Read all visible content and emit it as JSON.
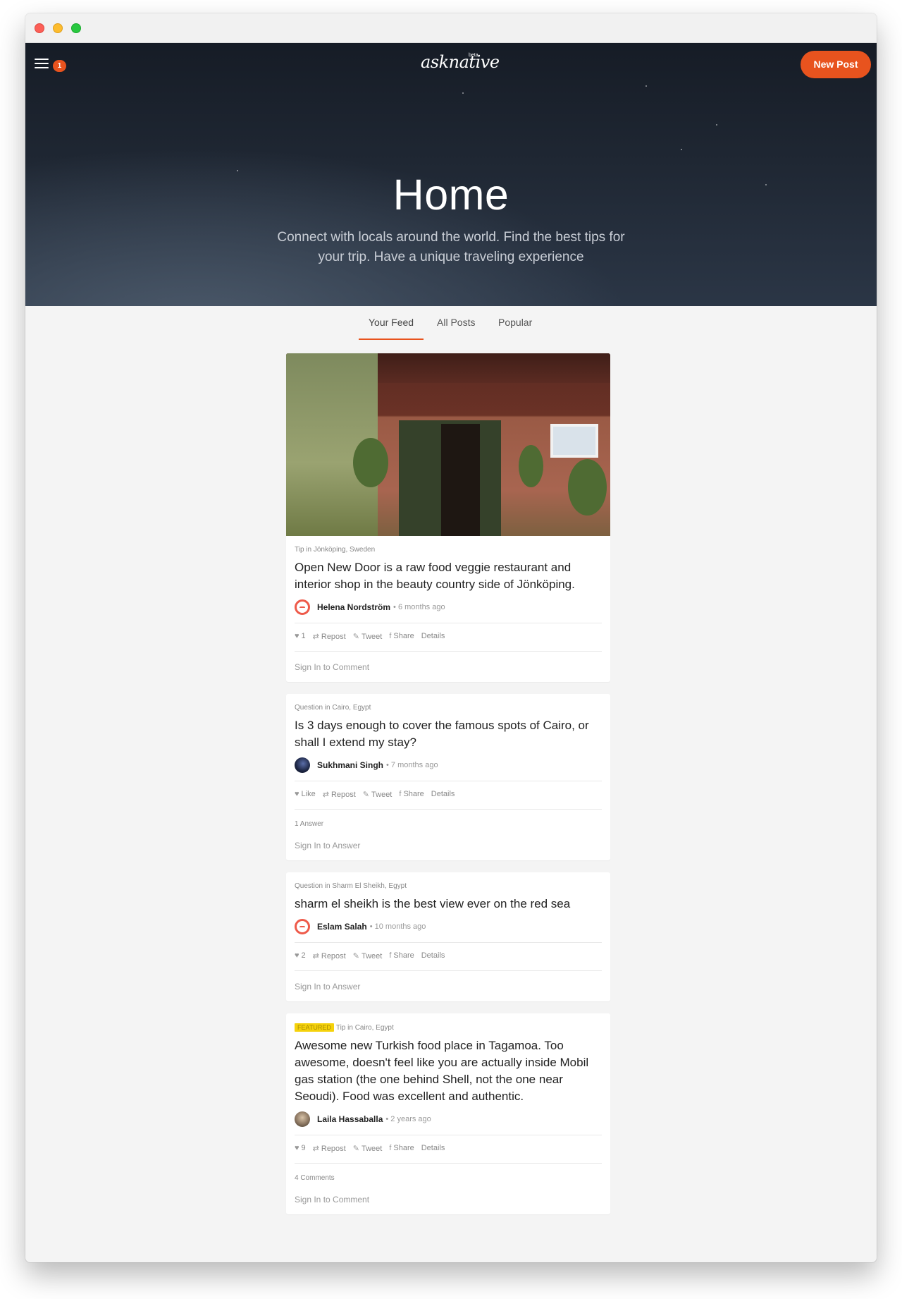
{
  "header": {
    "notification_count": "1",
    "logo": "asknative",
    "logo_suffix": "beta",
    "new_post_label": "New Post",
    "title": "Home",
    "subtitle": "Connect with locals around the world. Find the best tips for your trip. Have a unique traveling experience"
  },
  "tabs": [
    "Your Feed",
    "All Posts",
    "Popular"
  ],
  "active_tab": "Your Feed",
  "posts": [
    {
      "featured": "",
      "meta": "Tip in Jönköping, Sweden",
      "title": "Open New Door is a raw food veggie restaurant and interior shop in the beauty country side of Jönköping.",
      "author": "Helena Nordström",
      "time": "• 6 months ago",
      "like": "1",
      "repost": "Repost",
      "tweet": "Tweet",
      "share": "Share",
      "details": "Details",
      "count": "",
      "cta": "Sign In to Comment"
    },
    {
      "featured": "",
      "meta": "Question in Cairo, Egypt",
      "title": "Is 3 days enough to cover the famous spots of Cairo, or shall I extend my stay?",
      "author": "Sukhmani Singh",
      "time": "• 7 months ago",
      "like": "Like",
      "repost": "Repost",
      "tweet": "Tweet",
      "share": "Share",
      "details": "Details",
      "count": "1 Answer",
      "cta": "Sign In to Answer"
    },
    {
      "featured": "",
      "meta": "Question in Sharm El Sheikh, Egypt",
      "title": "sharm el sheikh is the best view ever on the red sea",
      "author": "Eslam Salah",
      "time": "• 10 months ago",
      "like": "2",
      "repost": "Repost",
      "tweet": "Tweet",
      "share": "Share",
      "details": "Details",
      "count": "",
      "cta": "Sign In to Answer"
    },
    {
      "featured": "FEATURED",
      "meta": "Tip in Cairo, Egypt",
      "title": "Awesome new Turkish food place in Tagamoa. Too awesome, doesn't feel like you are actually inside Mobil gas station (the one behind Shell, not the one near Seoudi). Food was excellent and authentic.",
      "author": "Laila Hassaballa",
      "time": "• 2 years ago",
      "like": "9",
      "repost": "Repost",
      "tweet": "Tweet",
      "share": "Share",
      "details": "Details",
      "count": "4 Comments",
      "cta": "Sign In to Comment"
    }
  ],
  "colors": {
    "accent": "#e8531e",
    "featured": "#f5d20b"
  },
  "icons": [
    "menu-icon",
    "heart-icon",
    "repost-icon",
    "twitter-icon",
    "facebook-icon"
  ]
}
